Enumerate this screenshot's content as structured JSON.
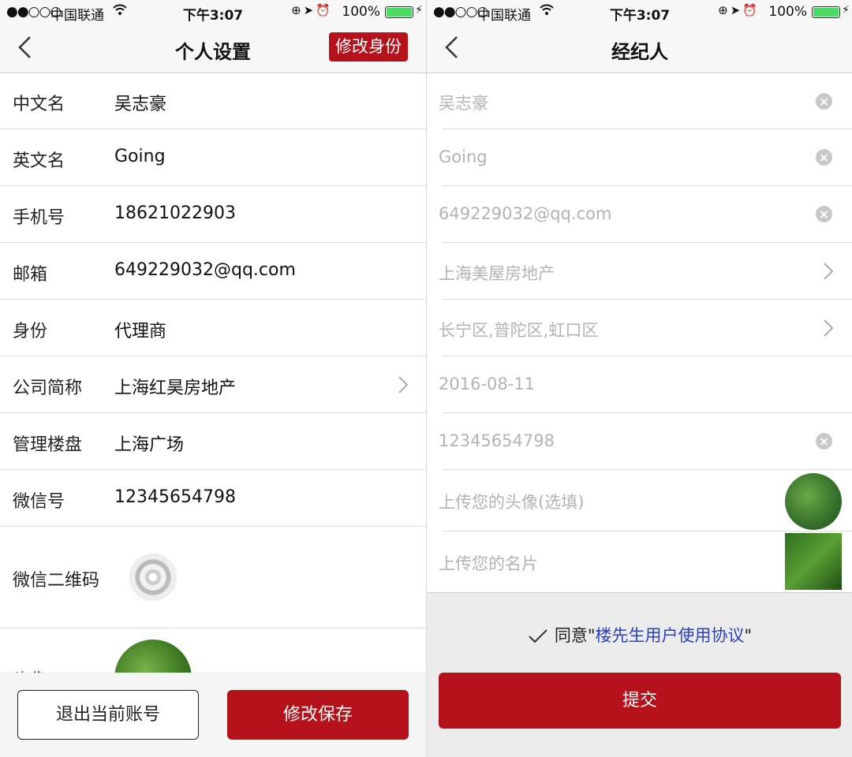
{
  "status_bar": {
    "signal": "●●○○○",
    "carrier": "中国联通",
    "time": "下午3:07",
    "battery": "100%"
  },
  "left": {
    "title": "个人设置",
    "role_button": "修改身份",
    "rows": [
      {
        "label": "中文名",
        "value": "吴志豪"
      },
      {
        "label": "英文名",
        "value": "Going"
      },
      {
        "label": "手机号",
        "value": "18621022903"
      },
      {
        "label": "邮箱",
        "value": "649229032@qq.com"
      },
      {
        "label": "身份",
        "value": "代理商"
      },
      {
        "label": "公司简称",
        "value": "上海红昊房地产"
      },
      {
        "label": "管理楼盘",
        "value": "上海广场"
      },
      {
        "label": "微信号",
        "value": "12345654798"
      },
      {
        "label": "微信二维码",
        "value": ""
      },
      {
        "label": "头像",
        "value": ""
      }
    ],
    "logout_button": "退出当前账号",
    "save_button": "修改保存"
  },
  "right": {
    "title": "经纪人",
    "fields": [
      {
        "value": "吴志豪",
        "accessory": "clear"
      },
      {
        "value": "Going",
        "accessory": "clear"
      },
      {
        "value": "649229032@qq.com",
        "accessory": "clear"
      },
      {
        "value": "上海美屋房地产",
        "accessory": "chevron"
      },
      {
        "value": "长宁区,普陀区,虹口区",
        "accessory": "chevron"
      },
      {
        "value": "2016-08-11",
        "accessory": "none"
      },
      {
        "value": "12345654798",
        "accessory": "clear"
      },
      {
        "value": "上传您的头像(选填)",
        "accessory": "image"
      },
      {
        "value": "上传您的名片",
        "accessory": "image"
      }
    ],
    "agree_prefix": "同意\"",
    "agree_link": "楼先生用户使用协议",
    "agree_suffix": "\"",
    "submit_button": "提交"
  },
  "colors": {
    "accent_red": "#b5121b",
    "link_blue": "#2b3fc7",
    "placeholder_gray": "#b3b3b3",
    "battery_green": "#4cd964"
  }
}
